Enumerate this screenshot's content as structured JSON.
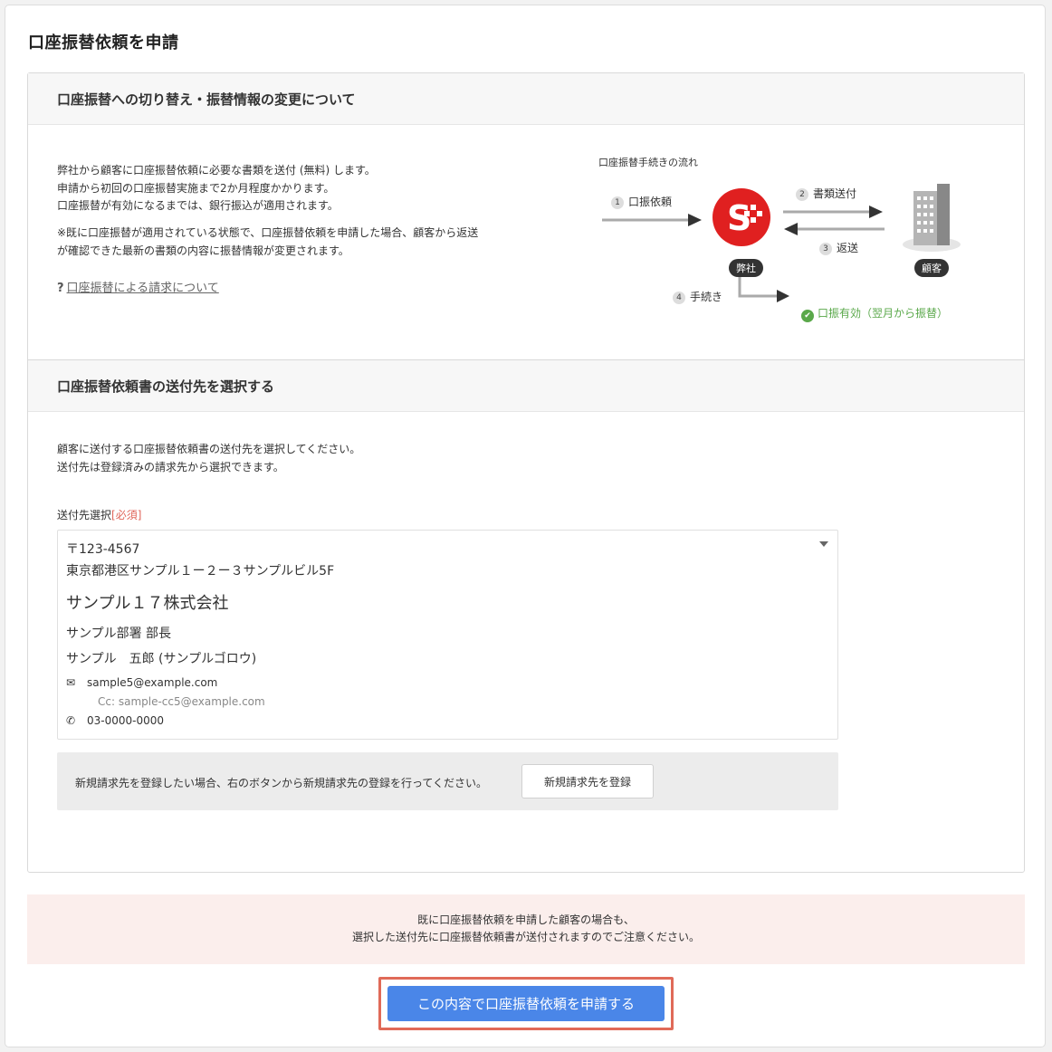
{
  "page": {
    "title": "口座振替依頼を申請"
  },
  "section1": {
    "header": "口座振替への切り替え・振替情報の変更について",
    "desc_lines": [
      "弊社から顧客に口座振替依頼に必要な書類を送付 (無料) します。",
      "申請から初回の口座振替実施まで2か月程度かかります。",
      "口座振替が有効になるまでは、銀行振込が適用されます。"
    ],
    "note_lines": [
      "※既に口座振替が適用されている状態で、口座振替依頼を申請した場合、顧客から返送",
      "が確認できた最新の書類の内容に振替情報が変更されます。"
    ],
    "help_link": "口座振替による請求について",
    "flow": {
      "title": "口座振替手続きの流れ",
      "step1": {
        "num": "1",
        "label": "口振依頼"
      },
      "step2": {
        "num": "2",
        "label": "書類送付"
      },
      "step3": {
        "num": "3",
        "label": "返送"
      },
      "step4": {
        "num": "4",
        "label": "手続き"
      },
      "company_label": "弊社",
      "customer_label": "顧客",
      "result": "口振有効（翌月から振替）"
    }
  },
  "section2": {
    "header": "口座振替依頼書の送付先を選択する",
    "desc_lines": [
      "顧客に送付する口座振替依頼書の送付先を選択してください。",
      "送付先は登録済みの請求先から選択できます。"
    ],
    "field_label": "送付先選択",
    "required": "[必須]",
    "selected": {
      "postal": "〒123-4567",
      "address": "東京都港区サンプル１ー２ー３サンプルビル5F",
      "company": "サンプル１７株式会社",
      "dept": "サンプル部署 部長",
      "person": "サンプル　五郎 (サンプルゴロウ)",
      "email": "sample5@example.com",
      "cc": "Cc: sample-cc5@example.com",
      "phone": "03-0000-0000"
    },
    "register_msg": "新規請求先を登録したい場合、右のボタンから新規請求先の登録を行ってください。",
    "register_button": "新規請求先を登録"
  },
  "notice": {
    "line1": "既に口座振替依頼を申請した顧客の場合も、",
    "line2": "選択した送付先に口座振替依頼書が送付されますのでご注意ください。"
  },
  "submit_button": "この内容で口座振替依頼を申請する",
  "colors": {
    "accent": "#4a86e8",
    "required": "#e0665a",
    "success": "#5aa84a",
    "logo": "#e02020"
  }
}
